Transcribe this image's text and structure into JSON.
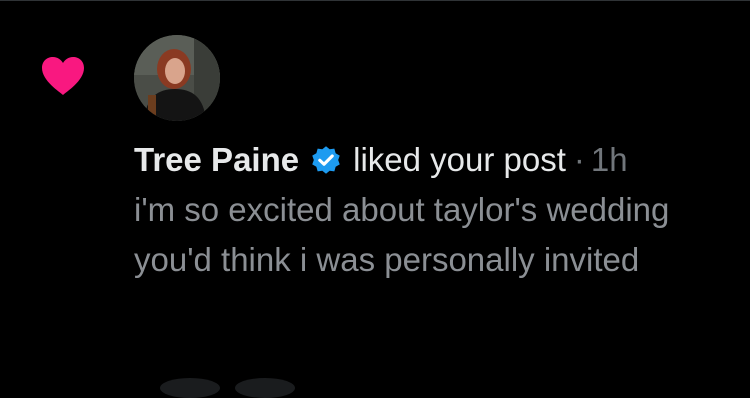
{
  "notification": {
    "user_name": "Tree Paine",
    "action": "liked your post",
    "separator": "·",
    "time": "1h",
    "post_text": "i'm so excited about taylor's wedding you'd think i was personally invited"
  },
  "icons": {
    "like": "heart-icon",
    "verified": "verified-badge-icon"
  },
  "colors": {
    "background": "#000000",
    "heart": "#f91880",
    "verified": "#1d9bf0",
    "primary_text": "#e7e9ea",
    "secondary_text": "#71767b",
    "divider": "#2f3336"
  }
}
